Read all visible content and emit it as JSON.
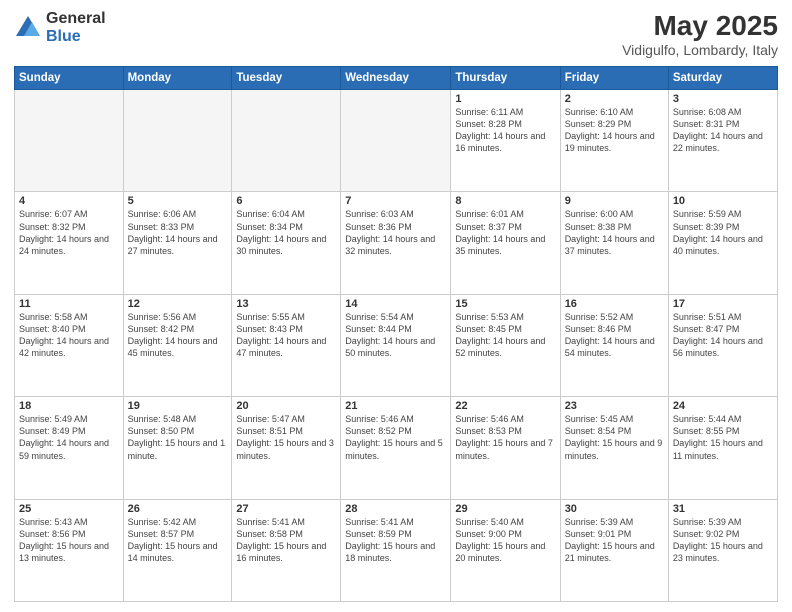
{
  "logo": {
    "general": "General",
    "blue": "Blue"
  },
  "title": {
    "month_year": "May 2025",
    "location": "Vidigulfo, Lombardy, Italy"
  },
  "headers": [
    "Sunday",
    "Monday",
    "Tuesday",
    "Wednesday",
    "Thursday",
    "Friday",
    "Saturday"
  ],
  "weeks": [
    [
      {
        "day": "",
        "info": ""
      },
      {
        "day": "",
        "info": ""
      },
      {
        "day": "",
        "info": ""
      },
      {
        "day": "",
        "info": ""
      },
      {
        "day": "1",
        "info": "Sunrise: 6:11 AM\nSunset: 8:28 PM\nDaylight: 14 hours and 16 minutes."
      },
      {
        "day": "2",
        "info": "Sunrise: 6:10 AM\nSunset: 8:29 PM\nDaylight: 14 hours and 19 minutes."
      },
      {
        "day": "3",
        "info": "Sunrise: 6:08 AM\nSunset: 8:31 PM\nDaylight: 14 hours and 22 minutes."
      }
    ],
    [
      {
        "day": "4",
        "info": "Sunrise: 6:07 AM\nSunset: 8:32 PM\nDaylight: 14 hours and 24 minutes."
      },
      {
        "day": "5",
        "info": "Sunrise: 6:06 AM\nSunset: 8:33 PM\nDaylight: 14 hours and 27 minutes."
      },
      {
        "day": "6",
        "info": "Sunrise: 6:04 AM\nSunset: 8:34 PM\nDaylight: 14 hours and 30 minutes."
      },
      {
        "day": "7",
        "info": "Sunrise: 6:03 AM\nSunset: 8:36 PM\nDaylight: 14 hours and 32 minutes."
      },
      {
        "day": "8",
        "info": "Sunrise: 6:01 AM\nSunset: 8:37 PM\nDaylight: 14 hours and 35 minutes."
      },
      {
        "day": "9",
        "info": "Sunrise: 6:00 AM\nSunset: 8:38 PM\nDaylight: 14 hours and 37 minutes."
      },
      {
        "day": "10",
        "info": "Sunrise: 5:59 AM\nSunset: 8:39 PM\nDaylight: 14 hours and 40 minutes."
      }
    ],
    [
      {
        "day": "11",
        "info": "Sunrise: 5:58 AM\nSunset: 8:40 PM\nDaylight: 14 hours and 42 minutes."
      },
      {
        "day": "12",
        "info": "Sunrise: 5:56 AM\nSunset: 8:42 PM\nDaylight: 14 hours and 45 minutes."
      },
      {
        "day": "13",
        "info": "Sunrise: 5:55 AM\nSunset: 8:43 PM\nDaylight: 14 hours and 47 minutes."
      },
      {
        "day": "14",
        "info": "Sunrise: 5:54 AM\nSunset: 8:44 PM\nDaylight: 14 hours and 50 minutes."
      },
      {
        "day": "15",
        "info": "Sunrise: 5:53 AM\nSunset: 8:45 PM\nDaylight: 14 hours and 52 minutes."
      },
      {
        "day": "16",
        "info": "Sunrise: 5:52 AM\nSunset: 8:46 PM\nDaylight: 14 hours and 54 minutes."
      },
      {
        "day": "17",
        "info": "Sunrise: 5:51 AM\nSunset: 8:47 PM\nDaylight: 14 hours and 56 minutes."
      }
    ],
    [
      {
        "day": "18",
        "info": "Sunrise: 5:49 AM\nSunset: 8:49 PM\nDaylight: 14 hours and 59 minutes."
      },
      {
        "day": "19",
        "info": "Sunrise: 5:48 AM\nSunset: 8:50 PM\nDaylight: 15 hours and 1 minute."
      },
      {
        "day": "20",
        "info": "Sunrise: 5:47 AM\nSunset: 8:51 PM\nDaylight: 15 hours and 3 minutes."
      },
      {
        "day": "21",
        "info": "Sunrise: 5:46 AM\nSunset: 8:52 PM\nDaylight: 15 hours and 5 minutes."
      },
      {
        "day": "22",
        "info": "Sunrise: 5:46 AM\nSunset: 8:53 PM\nDaylight: 15 hours and 7 minutes."
      },
      {
        "day": "23",
        "info": "Sunrise: 5:45 AM\nSunset: 8:54 PM\nDaylight: 15 hours and 9 minutes."
      },
      {
        "day": "24",
        "info": "Sunrise: 5:44 AM\nSunset: 8:55 PM\nDaylight: 15 hours and 11 minutes."
      }
    ],
    [
      {
        "day": "25",
        "info": "Sunrise: 5:43 AM\nSunset: 8:56 PM\nDaylight: 15 hours and 13 minutes."
      },
      {
        "day": "26",
        "info": "Sunrise: 5:42 AM\nSunset: 8:57 PM\nDaylight: 15 hours and 14 minutes."
      },
      {
        "day": "27",
        "info": "Sunrise: 5:41 AM\nSunset: 8:58 PM\nDaylight: 15 hours and 16 minutes."
      },
      {
        "day": "28",
        "info": "Sunrise: 5:41 AM\nSunset: 8:59 PM\nDaylight: 15 hours and 18 minutes."
      },
      {
        "day": "29",
        "info": "Sunrise: 5:40 AM\nSunset: 9:00 PM\nDaylight: 15 hours and 20 minutes."
      },
      {
        "day": "30",
        "info": "Sunrise: 5:39 AM\nSunset: 9:01 PM\nDaylight: 15 hours and 21 minutes."
      },
      {
        "day": "31",
        "info": "Sunrise: 5:39 AM\nSunset: 9:02 PM\nDaylight: 15 hours and 23 minutes."
      }
    ]
  ]
}
